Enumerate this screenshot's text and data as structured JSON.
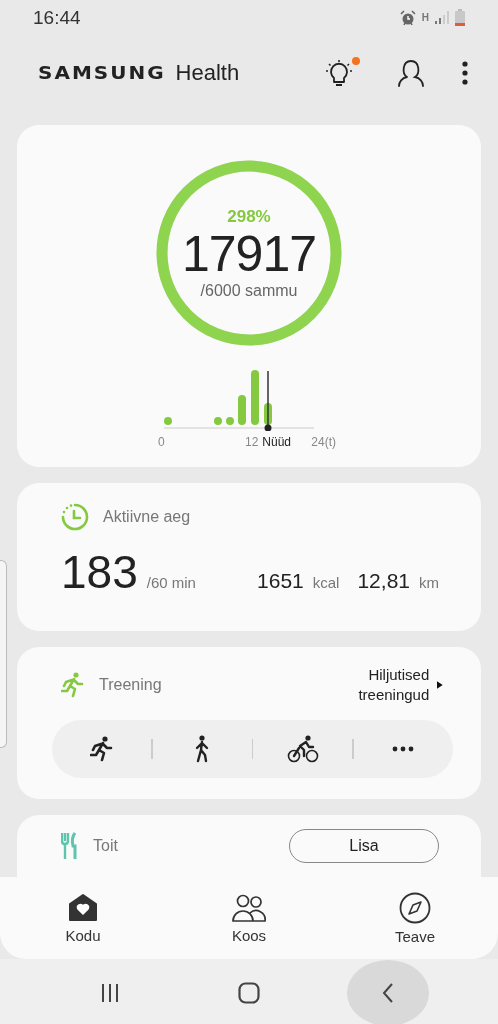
{
  "status_bar": {
    "time": "16:44",
    "network": "H"
  },
  "header": {
    "brand": "SAMSUNG",
    "title": "Health",
    "tips_badge": true
  },
  "steps": {
    "percent": "298%",
    "count": "17917",
    "goal": "/6000 sammu",
    "level": 1,
    "axis_start": "0",
    "axis_mid": "12",
    "now_label": "Nüüd",
    "axis_end": "24(t)"
  },
  "active_time": {
    "title": "Aktiivne aeg",
    "value": "183",
    "goal": "/60 min",
    "calories": "1651",
    "calories_unit": "kcal",
    "distance": "12,81",
    "distance_unit": "km"
  },
  "exercise": {
    "title": "Treening",
    "link": "Hiljutised treeningud",
    "shortcuts": [
      {
        "kind": "run"
      },
      {
        "kind": "walk"
      },
      {
        "kind": "cycle"
      },
      {
        "kind": "more"
      }
    ]
  },
  "food": {
    "title": "Toit",
    "button": "Lisa"
  },
  "tabs": [
    {
      "label": "Kodu",
      "kind": "home",
      "selected": true
    },
    {
      "label": "Koos",
      "kind": "together",
      "selected": false
    },
    {
      "label": "Teave",
      "kind": "discover",
      "selected": false
    }
  ]
}
